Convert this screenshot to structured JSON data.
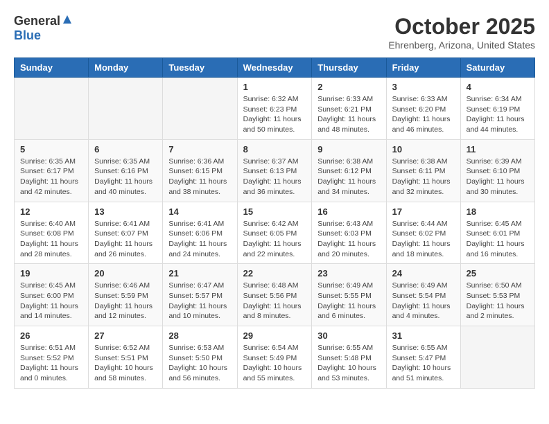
{
  "header": {
    "logo_general": "General",
    "logo_blue": "Blue",
    "title": "October 2025",
    "subtitle": "Ehrenberg, Arizona, United States"
  },
  "calendar": {
    "days_of_week": [
      "Sunday",
      "Monday",
      "Tuesday",
      "Wednesday",
      "Thursday",
      "Friday",
      "Saturday"
    ],
    "weeks": [
      [
        {
          "day": "",
          "info": ""
        },
        {
          "day": "",
          "info": ""
        },
        {
          "day": "",
          "info": ""
        },
        {
          "day": "1",
          "info": "Sunrise: 6:32 AM\nSunset: 6:23 PM\nDaylight: 11 hours and 50 minutes."
        },
        {
          "day": "2",
          "info": "Sunrise: 6:33 AM\nSunset: 6:21 PM\nDaylight: 11 hours and 48 minutes."
        },
        {
          "day": "3",
          "info": "Sunrise: 6:33 AM\nSunset: 6:20 PM\nDaylight: 11 hours and 46 minutes."
        },
        {
          "day": "4",
          "info": "Sunrise: 6:34 AM\nSunset: 6:19 PM\nDaylight: 11 hours and 44 minutes."
        }
      ],
      [
        {
          "day": "5",
          "info": "Sunrise: 6:35 AM\nSunset: 6:17 PM\nDaylight: 11 hours and 42 minutes."
        },
        {
          "day": "6",
          "info": "Sunrise: 6:35 AM\nSunset: 6:16 PM\nDaylight: 11 hours and 40 minutes."
        },
        {
          "day": "7",
          "info": "Sunrise: 6:36 AM\nSunset: 6:15 PM\nDaylight: 11 hours and 38 minutes."
        },
        {
          "day": "8",
          "info": "Sunrise: 6:37 AM\nSunset: 6:13 PM\nDaylight: 11 hours and 36 minutes."
        },
        {
          "day": "9",
          "info": "Sunrise: 6:38 AM\nSunset: 6:12 PM\nDaylight: 11 hours and 34 minutes."
        },
        {
          "day": "10",
          "info": "Sunrise: 6:38 AM\nSunset: 6:11 PM\nDaylight: 11 hours and 32 minutes."
        },
        {
          "day": "11",
          "info": "Sunrise: 6:39 AM\nSunset: 6:10 PM\nDaylight: 11 hours and 30 minutes."
        }
      ],
      [
        {
          "day": "12",
          "info": "Sunrise: 6:40 AM\nSunset: 6:08 PM\nDaylight: 11 hours and 28 minutes."
        },
        {
          "day": "13",
          "info": "Sunrise: 6:41 AM\nSunset: 6:07 PM\nDaylight: 11 hours and 26 minutes."
        },
        {
          "day": "14",
          "info": "Sunrise: 6:41 AM\nSunset: 6:06 PM\nDaylight: 11 hours and 24 minutes."
        },
        {
          "day": "15",
          "info": "Sunrise: 6:42 AM\nSunset: 6:05 PM\nDaylight: 11 hours and 22 minutes."
        },
        {
          "day": "16",
          "info": "Sunrise: 6:43 AM\nSunset: 6:03 PM\nDaylight: 11 hours and 20 minutes."
        },
        {
          "day": "17",
          "info": "Sunrise: 6:44 AM\nSunset: 6:02 PM\nDaylight: 11 hours and 18 minutes."
        },
        {
          "day": "18",
          "info": "Sunrise: 6:45 AM\nSunset: 6:01 PM\nDaylight: 11 hours and 16 minutes."
        }
      ],
      [
        {
          "day": "19",
          "info": "Sunrise: 6:45 AM\nSunset: 6:00 PM\nDaylight: 11 hours and 14 minutes."
        },
        {
          "day": "20",
          "info": "Sunrise: 6:46 AM\nSunset: 5:59 PM\nDaylight: 11 hours and 12 minutes."
        },
        {
          "day": "21",
          "info": "Sunrise: 6:47 AM\nSunset: 5:57 PM\nDaylight: 11 hours and 10 minutes."
        },
        {
          "day": "22",
          "info": "Sunrise: 6:48 AM\nSunset: 5:56 PM\nDaylight: 11 hours and 8 minutes."
        },
        {
          "day": "23",
          "info": "Sunrise: 6:49 AM\nSunset: 5:55 PM\nDaylight: 11 hours and 6 minutes."
        },
        {
          "day": "24",
          "info": "Sunrise: 6:49 AM\nSunset: 5:54 PM\nDaylight: 11 hours and 4 minutes."
        },
        {
          "day": "25",
          "info": "Sunrise: 6:50 AM\nSunset: 5:53 PM\nDaylight: 11 hours and 2 minutes."
        }
      ],
      [
        {
          "day": "26",
          "info": "Sunrise: 6:51 AM\nSunset: 5:52 PM\nDaylight: 11 hours and 0 minutes."
        },
        {
          "day": "27",
          "info": "Sunrise: 6:52 AM\nSunset: 5:51 PM\nDaylight: 10 hours and 58 minutes."
        },
        {
          "day": "28",
          "info": "Sunrise: 6:53 AM\nSunset: 5:50 PM\nDaylight: 10 hours and 56 minutes."
        },
        {
          "day": "29",
          "info": "Sunrise: 6:54 AM\nSunset: 5:49 PM\nDaylight: 10 hours and 55 minutes."
        },
        {
          "day": "30",
          "info": "Sunrise: 6:55 AM\nSunset: 5:48 PM\nDaylight: 10 hours and 53 minutes."
        },
        {
          "day": "31",
          "info": "Sunrise: 6:55 AM\nSunset: 5:47 PM\nDaylight: 10 hours and 51 minutes."
        },
        {
          "day": "",
          "info": ""
        }
      ]
    ]
  }
}
